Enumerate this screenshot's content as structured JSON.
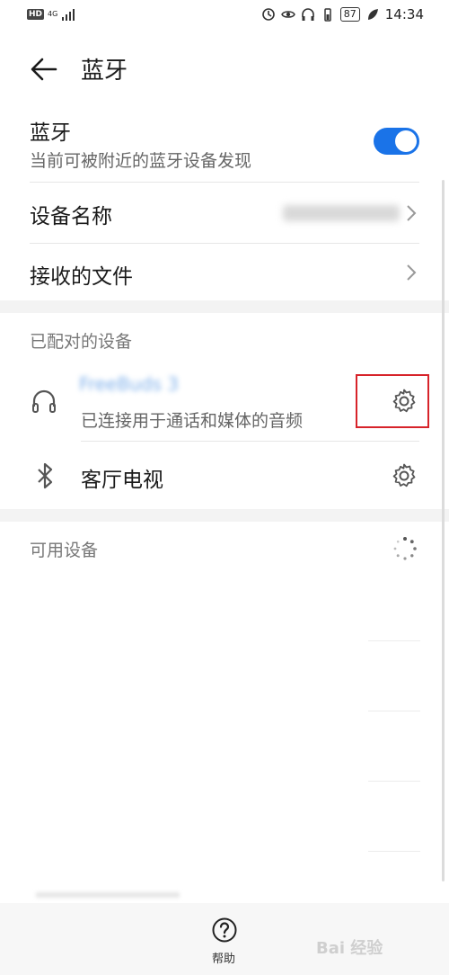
{
  "status_bar": {
    "hd": "HD",
    "network": "4G",
    "battery": "87",
    "time": "14:34"
  },
  "header": {
    "title": "蓝牙"
  },
  "bluetooth": {
    "label": "蓝牙",
    "description": "当前可被附近的蓝牙设备发现",
    "enabled": true,
    "accent_color": "#1a73e8"
  },
  "device_name": {
    "label": "设备名称"
  },
  "received_files": {
    "label": "接收的文件"
  },
  "paired_section": {
    "title": "已配对的设备",
    "devices": [
      {
        "icon": "headphones-icon",
        "status": "已连接用于通话和媒体的音频"
      },
      {
        "icon": "bluetooth-icon",
        "name": "客厅电视"
      }
    ]
  },
  "available_section": {
    "title": "可用设备"
  },
  "bottom": {
    "help_label": "帮助"
  },
  "watermark": "Bai 经验",
  "highlight_color": "#d7232a"
}
